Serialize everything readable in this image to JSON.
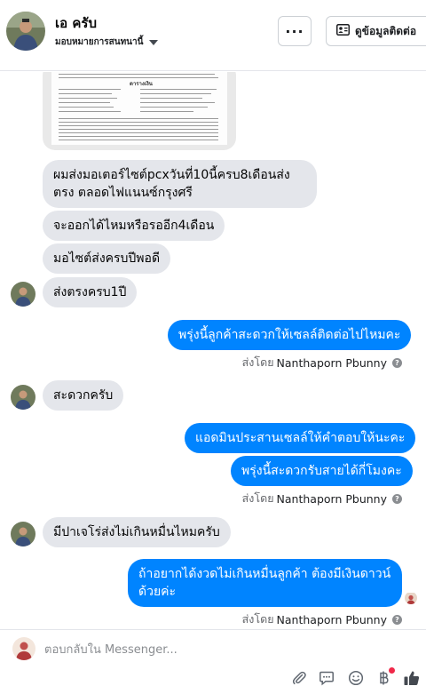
{
  "header": {
    "contact_name": "เอ ครับ",
    "assign_label": "มอบหมายการสนทนานี้",
    "more_label": "···",
    "contact_info_label": "ดูข้อมูลติดต่อ"
  },
  "colors": {
    "outgoing_bubble": "#0084ff",
    "incoming_bubble": "#e4e6eb",
    "secondary_text": "#65676b",
    "notification_dot": "#f02849"
  },
  "messages": [
    {
      "direction": "incoming",
      "type": "image",
      "image_title": "ตารางเงิน"
    },
    {
      "direction": "incoming",
      "text": "ผมส่งมอเตอร์ไซต์pcxวันที่10นี้ครบ8เดือนส่งตรง ตลอดไฟแนนซ์กรุงศรี"
    },
    {
      "direction": "incoming",
      "text": "จะออกได้ไหมหรือรออีก4เดือน"
    },
    {
      "direction": "incoming",
      "text": "มอไซต์ส่งครบปีพอดี"
    },
    {
      "direction": "incoming",
      "text": "ส่งตรงครบ1ปี"
    },
    {
      "direction": "outgoing",
      "text": "พรุ่งนี้ลูกค้าสะดวกให้เซลล์ติดต่อไปไหมคะ"
    },
    {
      "direction": "incoming",
      "text": "สะดวกครับ"
    },
    {
      "direction": "outgoing",
      "text": "แอดมินประสานเซลล์ให้คำตอบให้นะคะ"
    },
    {
      "direction": "outgoing",
      "text": "พรุ่งนี้สะดวกรับสายได้กี่โมงคะ"
    },
    {
      "direction": "incoming",
      "text": "มีปาเจโร่ส่งไม่เกินหมื่นไหมครับ"
    },
    {
      "direction": "outgoing",
      "text": "ถ้าอยากได้งวดไม่เกินหมื่นลูกค้า ต้องมีเงินดาวน์ด้วยค่ะ"
    }
  ],
  "sent_by": {
    "prefix": "ส่งโดย",
    "sender": "Nanthaporn Pbunny"
  },
  "composer": {
    "placeholder": "ตอบกลับใน Messenger..."
  },
  "toolbar_icons": [
    "paperclip-icon",
    "chat-bubble-icon",
    "smiley-icon",
    "baht-icon",
    "thumbs-up-icon"
  ]
}
